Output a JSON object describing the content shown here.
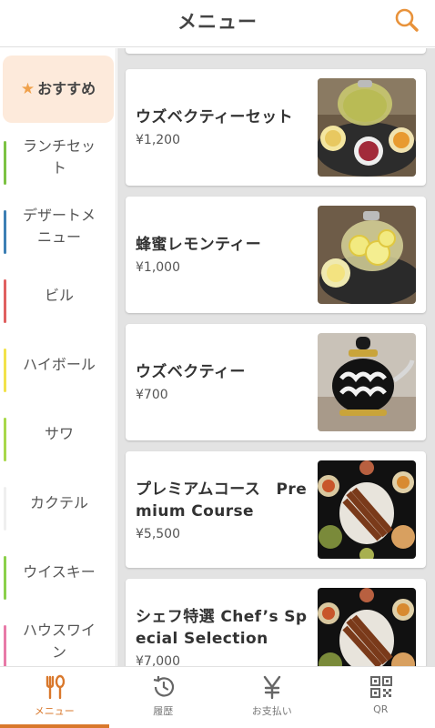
{
  "header": {
    "title": "メニュー",
    "search_icon": "search-icon"
  },
  "sidebar": {
    "selected": {
      "label": "おすすめ",
      "icon": "star-icon",
      "background": "#fdeadb"
    },
    "items": [
      {
        "label": "ランチセット",
        "color": "#7cc243"
      },
      {
        "label": "デザートメニュー",
        "color": "#3c7fb4"
      },
      {
        "label": "ビル",
        "color": "#e06060"
      },
      {
        "label": "ハイボール",
        "color": "#f2e24a"
      },
      {
        "label": "サワ",
        "color": "#a8d84a"
      },
      {
        "label": "カクテル",
        "color": "#f2f2f2"
      },
      {
        "label": "ウイスキー",
        "color": "#8bd04a"
      },
      {
        "label": "ハウスワイン",
        "color": "#e87aa8"
      }
    ]
  },
  "menu": [
    {
      "name": "ウズベクティーセット",
      "price": "¥1,200",
      "image": "tea-set-photo"
    },
    {
      "name": "蜂蜜レモンティー",
      "price": "¥1,000",
      "image": "honey-lemon-tea-photo"
    },
    {
      "name": "ウズベクティー",
      "price": "¥700",
      "image": "uzbek-teapot-photo"
    },
    {
      "name": "プレミアムコース　Premium Course",
      "price": "¥5,500",
      "image": "premium-course-photo"
    },
    {
      "name": "シェフ特選 Chef’s Special Selection",
      "price": "¥7,000",
      "image": "chef-selection-photo"
    }
  ],
  "tabs": [
    {
      "label": "メニュー",
      "icon": "fork-knife-icon",
      "active": true
    },
    {
      "label": "履歴",
      "icon": "history-icon",
      "active": false
    },
    {
      "label": "お支払い",
      "icon": "yen-icon",
      "active": false
    },
    {
      "label": "QR",
      "icon": "qr-code-icon",
      "active": false
    }
  ],
  "colors": {
    "accent": "#d9782c",
    "search": "#e8923a"
  }
}
